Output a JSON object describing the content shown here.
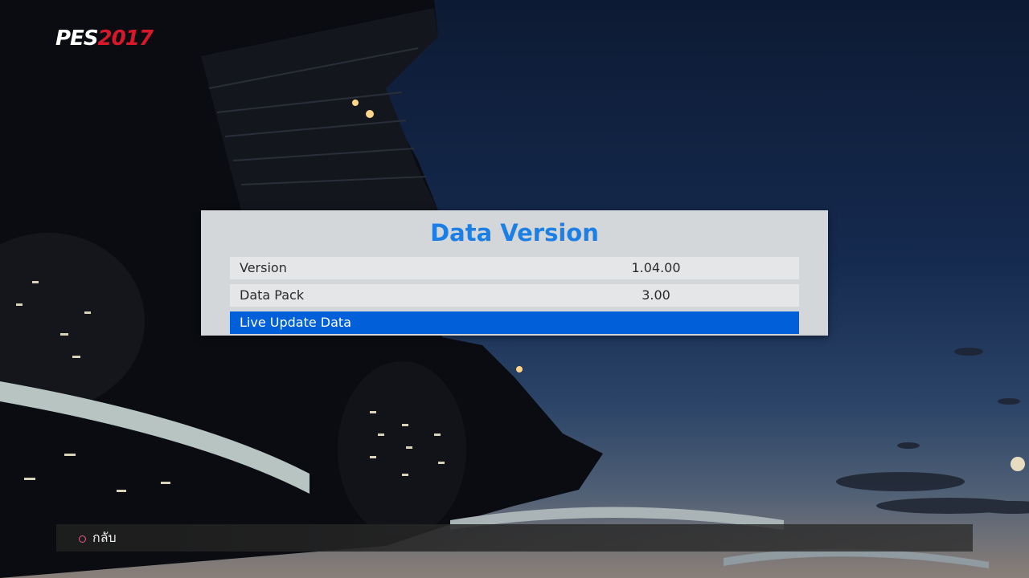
{
  "logo": {
    "brand": "PES",
    "year": "2017",
    "colors": {
      "brand": "#ffffff",
      "year": "#d7182a"
    }
  },
  "dialog": {
    "title": "Data Version",
    "title_color": "#1b7fe6",
    "rows": [
      {
        "label": "Version",
        "value": "1.04.00"
      },
      {
        "label": "Data Pack",
        "value": "3.00"
      },
      {
        "label": "Live Update Data",
        "value": "",
        "selected": true
      }
    ],
    "selected_color": "#005fd9"
  },
  "footer": {
    "back_icon": "circle-button-icon",
    "back_label": "กลับ"
  }
}
